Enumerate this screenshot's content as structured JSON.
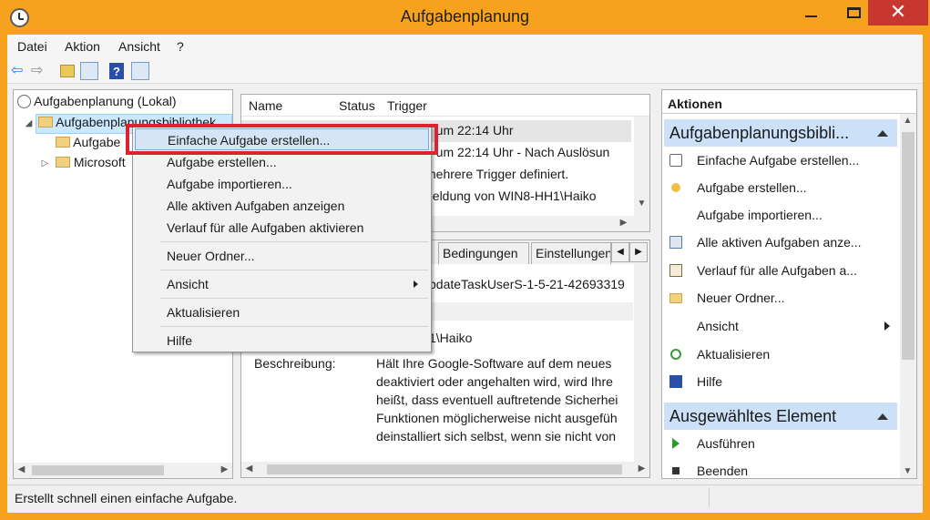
{
  "window": {
    "title": "Aufgabenplanung",
    "minimize_icon": "minimize-icon",
    "maximize_icon": "maximize-icon",
    "close_icon": "close-icon",
    "close_glyph": "✕"
  },
  "menubar": {
    "items": [
      "Datei",
      "Aktion",
      "Ansicht",
      "?"
    ]
  },
  "toolbar": {
    "icons": [
      "back-arrow-icon",
      "forward-arrow-icon",
      "up-folder-icon",
      "show-hide-tree-icon",
      "help-icon",
      "show-hide-action-pane-icon"
    ],
    "help_glyph": "?",
    "back_glyph": "⇦",
    "forward_glyph": "⇨"
  },
  "tree": {
    "root": "Aufgabenplanung (Lokal)",
    "library": "Aufgabenplanungsbibliothek",
    "child1": "Aufgabe",
    "child2": "Microsoft"
  },
  "list": {
    "columns": [
      "Name",
      "Status",
      "Trigger"
    ],
    "rows": [
      "g um 22:14 Uhr",
      "g um 22:14 Uhr - Nach Auslösun",
      "mehrere Trigger definiert.",
      "neldung von WIN8-HH1\\Haiko"
    ]
  },
  "details": {
    "tabs": [
      "Bedingungen",
      "Einstellungen"
    ],
    "tab_prev_glyph": "◀",
    "tab_next_glyph": "▶",
    "task_name": "pdateTaskUserS-1-5-21-42693319",
    "author": "1\\Haiko",
    "description_label": "Beschreibung:",
    "description_lines": [
      "Hält Ihre Google-Software auf dem neues",
      "deaktiviert oder angehalten wird, wird Ihre",
      "heißt, dass eventuell auftretende Sicherhei",
      "Funktionen möglicherweise nicht ausgefüh",
      "deinstalliert sich selbst, wenn sie nicht von"
    ]
  },
  "actions": {
    "header": "Aktionen",
    "section1": "Aufgabenplanungsbibli...",
    "items1": [
      {
        "label": "Einfache Aufgabe erstellen...",
        "icon": "create-basic-task-icon"
      },
      {
        "label": "Aufgabe erstellen...",
        "icon": "create-task-icon"
      },
      {
        "label": "Aufgabe importieren...",
        "icon": ""
      },
      {
        "label": "Alle aktiven Aufgaben anze...",
        "icon": "active-tasks-icon"
      },
      {
        "label": "Verlauf für alle Aufgaben a...",
        "icon": "history-icon"
      },
      {
        "label": "Neuer Ordner...",
        "icon": "new-folder-icon"
      },
      {
        "label": "Ansicht",
        "icon": ""
      },
      {
        "label": "Aktualisieren",
        "icon": "refresh-icon"
      },
      {
        "label": "Hilfe",
        "icon": "help-icon"
      }
    ],
    "section2": "Ausgewähltes Element",
    "items2": [
      {
        "label": "Ausführen",
        "icon": "run-icon"
      },
      {
        "label": "Beenden",
        "icon": "stop-icon"
      }
    ]
  },
  "context_menu": {
    "items": [
      "Einfache Aufgabe erstellen...",
      "Aufgabe erstellen...",
      "Aufgabe importieren...",
      "Alle aktiven Aufgaben anzeigen",
      "Verlauf für alle Aufgaben aktivieren",
      "Neuer Ordner...",
      "Ansicht",
      "Aktualisieren",
      "Hilfe"
    ],
    "highlight_color": "#e0202e"
  },
  "statusbar": {
    "text": "Erstellt schnell einen einfache Aufgabe."
  },
  "colors": {
    "window_frame": "#f6a21e",
    "close_button": "#c7372f",
    "section_header": "#cce1f7",
    "selection": "#cce8ff"
  }
}
